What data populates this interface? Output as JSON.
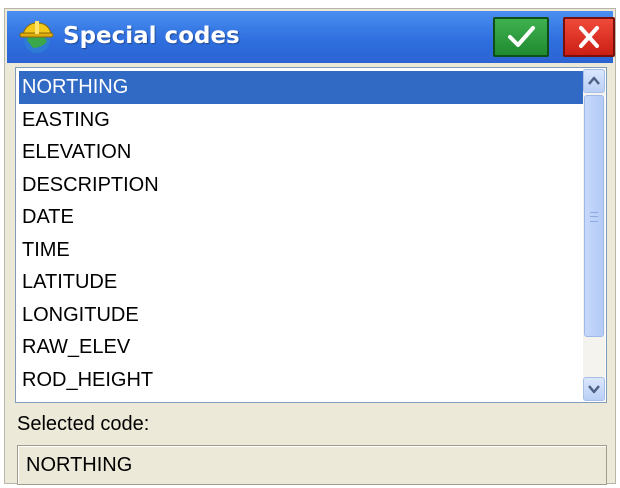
{
  "window": {
    "title": "Special codes",
    "icon": "hardhat-globe-icon",
    "ok_icon": "checkmark-icon",
    "cancel_icon": "close-icon"
  },
  "codes": [
    "NORTHING",
    "EASTING",
    "ELEVATION",
    "DESCRIPTION",
    "DATE",
    "TIME",
    "LATITUDE",
    "LONGITUDE",
    "RAW_ELEV",
    "ROD_HEIGHT"
  ],
  "selected_index": 0,
  "selected_section": {
    "label": "Selected code:",
    "value": "NORTHING"
  },
  "colors": {
    "title_bar": "#2f6fdf",
    "selection": "#316ac5",
    "ok_button": "#2a9b3b",
    "cancel_button": "#e0281b"
  }
}
